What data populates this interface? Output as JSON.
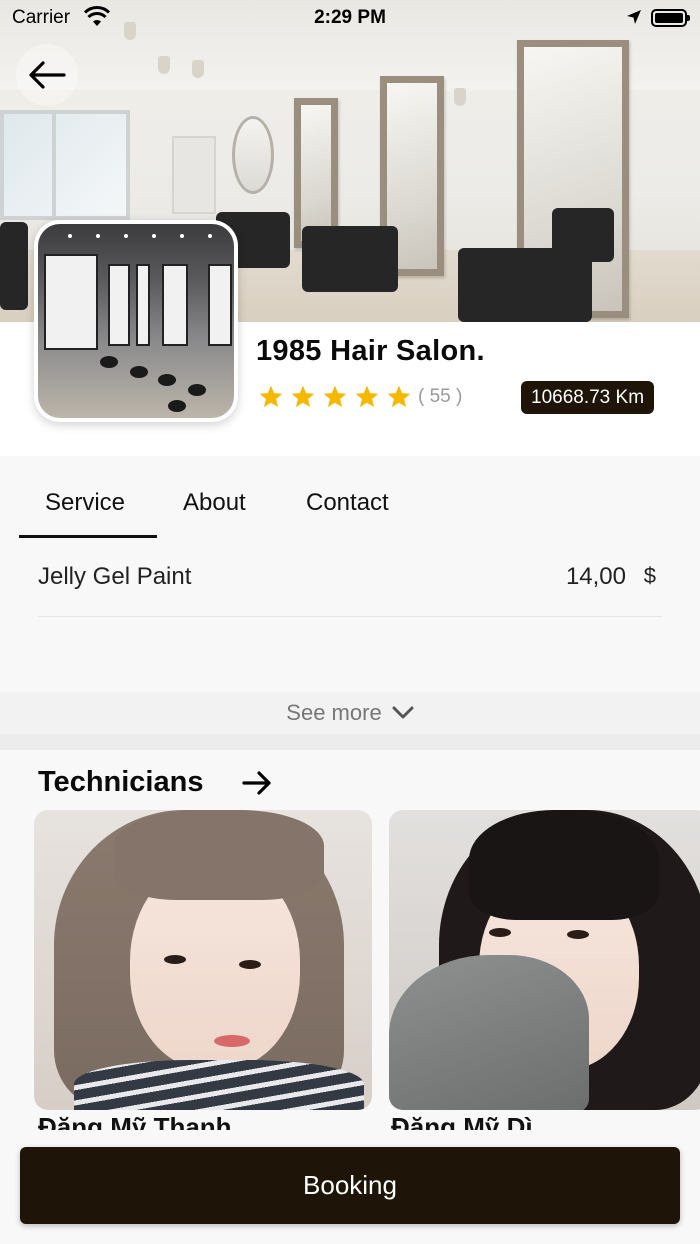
{
  "status_bar": {
    "carrier": "Carrier",
    "time": "2:29 PM"
  },
  "salon": {
    "name": "1985 Hair Salon.",
    "rating": 5,
    "reviews": "( 55 )",
    "distance": "10668.73 Km"
  },
  "tabs": [
    {
      "label": "Service",
      "active": true
    },
    {
      "label": "About",
      "active": false
    },
    {
      "label": "Contact",
      "active": false
    }
  ],
  "services": [
    {
      "name": "Jelly Gel Paint",
      "price": "14,00",
      "currency": "$"
    }
  ],
  "see_more": "See more",
  "technicians": {
    "title": "Technicians",
    "items": [
      {
        "name": "Đặng Mỹ Thanh"
      },
      {
        "name": "Đặng Mỹ Dì"
      }
    ]
  },
  "booking_label": "Booking",
  "colors": {
    "accent": "#1e1407",
    "star": "#f5b800"
  },
  "icons": [
    "wifi-icon",
    "location-arrow-icon",
    "battery-icon",
    "back-arrow-icon",
    "star-icon",
    "chevron-down-icon",
    "arrow-right-icon"
  ]
}
